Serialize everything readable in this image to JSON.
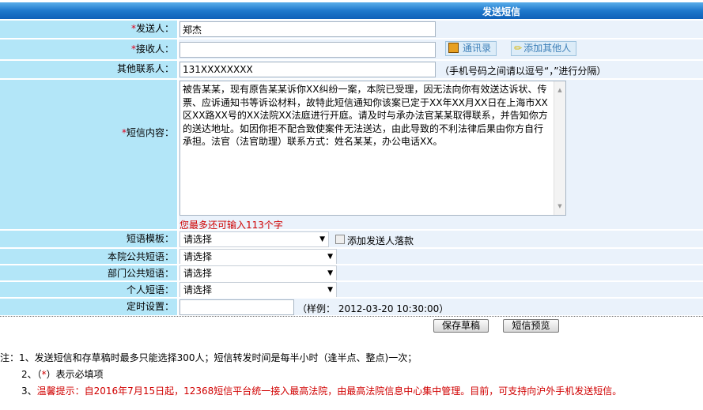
{
  "header": {
    "title": "发送短信"
  },
  "form": {
    "required_mark": "*",
    "sender_label": "发送人：",
    "sender_value": "郑杰",
    "receiver_label": "接收人：",
    "receiver_value": "",
    "contacts_button": "通讯录",
    "add_others_button": "添加其他人",
    "other_contacts_label": "其他联系人：",
    "other_contacts_value": "131XXXXXXXX",
    "other_contacts_hint": "（手机号码之间请以逗号“，”进行分隔）",
    "content_label": "短信内容：",
    "content_value": "被告某某，现有原告某某诉你XX纠纷一案，本院已受理，因无法向你有效送达诉状、传票、应诉通知书等诉讼材料，故特此短信通知你该案已定于XX年XX月XX日在上海市XX区XX路XX号的XX法院XX法庭进行开庭。请及时与承办法官某某取得联系，并告知你方的送达地址。如因你拒不配合致使案件无法送达，由此导致的不利法律后果由你方自行承担。法官（法官助理）联系方式：姓名某某，办公电话XX。",
    "remaining_text": "您最多还可输入113个字",
    "template_label": "短语模板：",
    "template_value": "请选择",
    "add_signature_label": "添加发送人落款",
    "add_signature_checked": false,
    "court_phrase_label": "本院公共短语：",
    "court_phrase_value": "请选择",
    "dept_phrase_label": "部门公共短语：",
    "dept_phrase_value": "请选择",
    "personal_phrase_label": "个人短语：",
    "personal_phrase_value": "请选择",
    "schedule_label": "定时设置：",
    "schedule_value": "",
    "schedule_example": "（样例：  2012-03-20 10:30:00）"
  },
  "actions": {
    "save_draft": "保存草稿",
    "preview": "短信预览"
  },
  "notes": {
    "line1": "注：1、发送短信和存草稿时最多只能选择300人；短信转发时间是每半小时（逢半点、整点)一次；",
    "line2_prefix": "2、（",
    "line2_star": "*",
    "line2_suffix": "）表示必填项",
    "line3_prefix": "3、",
    "line3_text": "温馨提示：自2016年7月15日起，12368短信平台统一接入最高法院，由最高法院信息中心集中管理。目前，可支持向沪外手机发送短信。"
  }
}
